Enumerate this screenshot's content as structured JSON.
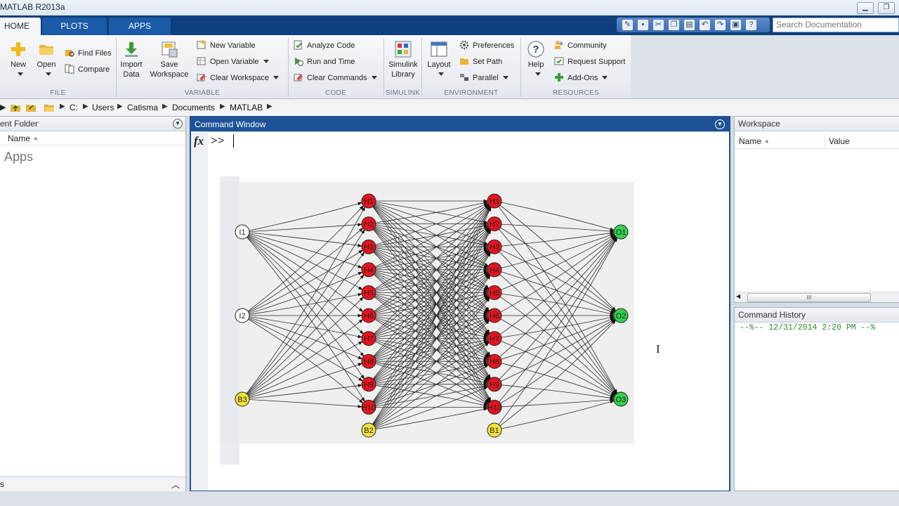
{
  "window": {
    "title": "MATLAB R2013a",
    "min": "▁",
    "restore": "❐"
  },
  "tabs": [
    {
      "label": "HOME"
    },
    {
      "label": "PLOTS"
    },
    {
      "label": "APPS"
    }
  ],
  "search": {
    "placeholder": "Search Documentation"
  },
  "ribbon": {
    "file": {
      "group": "FILE",
      "new": "New",
      "open": "Open",
      "find_files": "Find Files",
      "compare": "Compare"
    },
    "variable": {
      "group": "VARIABLE",
      "import_line1": "Import",
      "import_line2": "Data",
      "save_line1": "Save",
      "save_line2": "Workspace",
      "new_variable": "New Variable",
      "open_variable": "Open Variable",
      "clear_workspace": "Clear Workspace"
    },
    "code": {
      "group": "CODE",
      "analyze": "Analyze Code",
      "run_time": "Run and Time",
      "clear_commands": "Clear Commands"
    },
    "simulink": {
      "group": "SIMULINK",
      "line1": "Simulink",
      "line2": "Library"
    },
    "environment": {
      "group": "ENVIRONMENT",
      "layout": "Layout",
      "preferences": "Preferences",
      "set_path": "Set Path",
      "parallel": "Parallel"
    },
    "resources": {
      "group": "RESOURCES",
      "help": "Help",
      "community": "Community",
      "request_support": "Request Support",
      "addons": "Add-Ons"
    }
  },
  "address": {
    "path": [
      "C:",
      "Users",
      "Catisma",
      "Documents",
      "MATLAB"
    ]
  },
  "current_folder": {
    "title": "ent Folder",
    "col_name": "Name",
    "items": [
      "Apps"
    ],
    "footer": "s"
  },
  "command_window": {
    "title": "Command Window",
    "fx": "fx",
    "prompt": ">>"
  },
  "network": {
    "inputs": [
      "I1",
      "I2"
    ],
    "bias_input": "B3",
    "hidden1": [
      "H1",
      "H2",
      "H3",
      "H4",
      "H5",
      "H6",
      "H7",
      "H8",
      "H9",
      "H10"
    ],
    "hidden2": [
      "H1",
      "H2",
      "H3",
      "H4",
      "H5",
      "H6",
      "H7",
      "H8",
      "H9",
      "H10"
    ],
    "bias_hidden1": "B2",
    "bias_hidden2": "B1",
    "outputs": [
      "O1",
      "O2",
      "O3"
    ],
    "colors": {
      "input": "#ffffff",
      "bias": "#f5e23a",
      "hidden": "#e8141c",
      "output": "#2fd34a"
    }
  },
  "workspace": {
    "title": "Workspace",
    "col_name": "Name",
    "col_value": "Value",
    "scroll_mark": "III"
  },
  "command_history": {
    "title": "Command History",
    "entries": [
      "--%-- 12/31/2014 2:20 PM --%"
    ]
  }
}
